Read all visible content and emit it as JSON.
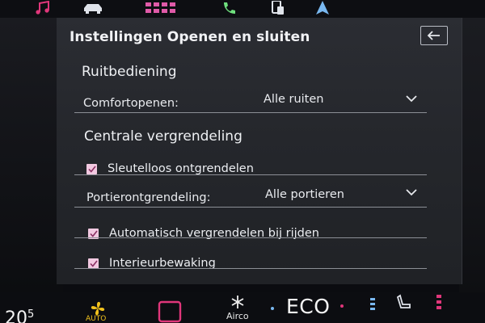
{
  "panel": {
    "title": "Instellingen Openen en sluiten",
    "back_icon": "back-arrow-icon"
  },
  "sections": {
    "window": {
      "title": "Ruitbediening",
      "comfort_label": "Comfortopenen:",
      "comfort_value": "Alle ruiten"
    },
    "locking": {
      "title": "Centrale vergrendeling",
      "keyless_label": "Sleutelloos ontgrendelen",
      "keyless_checked": true,
      "door_label": "Portierontgrendeling:",
      "door_value": "Alle portieren",
      "autolock_label": "Automatisch vergrendelen bij rijden",
      "autolock_checked": true,
      "interior_label": "Interieurbewaking",
      "interior_checked": true
    }
  },
  "top_nav": {
    "icons": [
      "music-note-icon",
      "car-icon",
      "apps-grid-icon",
      "phone-icon",
      "phone-device-icon",
      "navigation-arrow-icon"
    ]
  },
  "bottom_bar": {
    "temperature": "20",
    "temperature_unit": "5",
    "fan_label": "AUTO",
    "airco_label": "Airco",
    "eco_label": "ECO"
  },
  "colors": {
    "accent_pink": "#e0367a",
    "checkbox": "#f2c9e1",
    "fan_yellow": "#f2c21d",
    "nav_blue": "#79b8f0",
    "phone_green": "#6fe07e"
  }
}
